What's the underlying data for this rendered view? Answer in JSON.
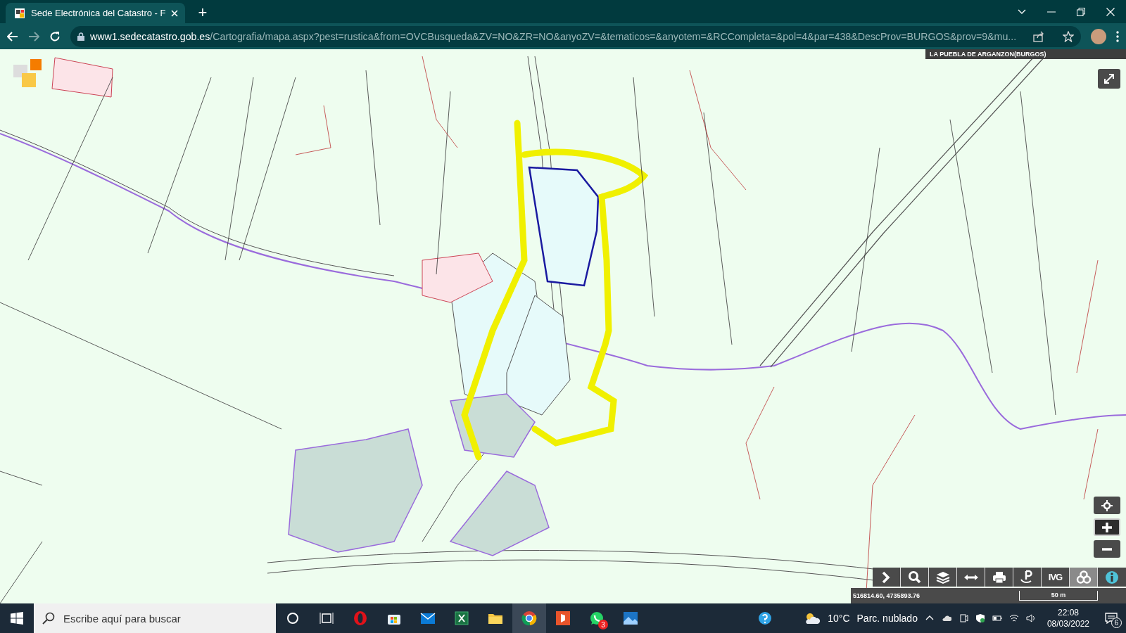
{
  "browser": {
    "tab": {
      "title": "Sede Electrónica del Catastro - F",
      "selected": true
    },
    "new_tab": "+",
    "url_host": "www1.sedecatastro.gob.es",
    "url_path": "/Cartografia/mapa.aspx?pest=rustica&from=OVCBusqueda&ZV=NO&ZR=NO&anyoZV=&tematicos=&anyotem=&RCCompleta=&pol=4&par=438&DescProv=BURGOS&prov=9&mu..."
  },
  "map": {
    "region_label": "LA PUEBLA DE ARGANZON(BURGOS)",
    "coordinates": "516814.60, 4735893.76",
    "scale": "50 m",
    "toolbar": [
      {
        "kind": "chevron",
        "selected": false
      },
      {
        "kind": "search",
        "selected": false
      },
      {
        "kind": "layers",
        "selected": false
      },
      {
        "kind": "measure",
        "selected": false
      },
      {
        "kind": "print",
        "selected": false
      },
      {
        "kind": "parking",
        "selected": false
      },
      {
        "kind": "text",
        "label": "IVG",
        "selected": false
      },
      {
        "kind": "circles",
        "selected": true
      },
      {
        "kind": "info",
        "selected": false
      }
    ]
  },
  "taskbar": {
    "search_placeholder": "Escribe aquí para buscar",
    "whatsapp_badge": "3",
    "temperature": "10°C",
    "weather": "Parc. nublado",
    "time": "22:08",
    "date": "08/03/2022",
    "notifications": "6"
  }
}
